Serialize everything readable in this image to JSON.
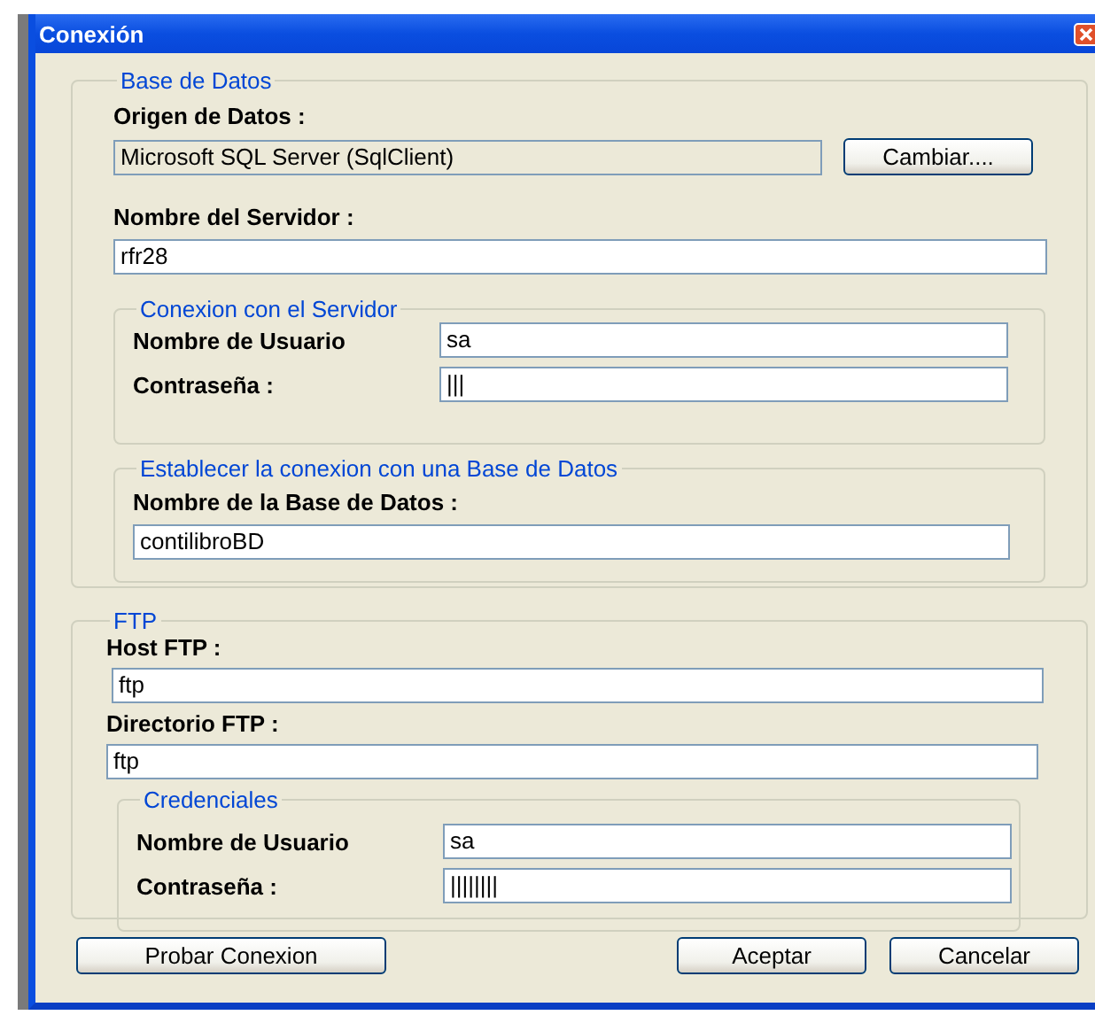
{
  "window": {
    "title": "Conexión"
  },
  "database": {
    "legend": "Base de Datos",
    "source_label": "Origen de Datos :",
    "source_value": "Microsoft SQL Server (SqlClient)",
    "change_button": "Cambiar....",
    "server_label": "Nombre del Servidor :",
    "server_value": "rfr28",
    "server_connection": {
      "legend": "Conexion con el Servidor",
      "user_label": "Nombre de Usuario",
      "user_value": "sa",
      "password_label": "Contraseña :",
      "password_value": "|||"
    },
    "db_connection": {
      "legend": "Establecer la conexion con una Base de Datos",
      "db_label": "Nombre de la Base de Datos :",
      "db_value": "contilibroBD"
    }
  },
  "ftp": {
    "legend": "FTP",
    "host_label": "Host FTP :",
    "host_value": "ftp",
    "dir_label": "Directorio FTP :",
    "dir_value": "ftp",
    "credentials": {
      "legend": "Credenciales",
      "user_label": "Nombre de Usuario",
      "user_value": "sa",
      "password_label": "Contraseña :",
      "password_value": "||||||||"
    }
  },
  "buttons": {
    "test": "Probar Conexion",
    "accept": "Aceptar",
    "cancel": "Cancelar"
  }
}
